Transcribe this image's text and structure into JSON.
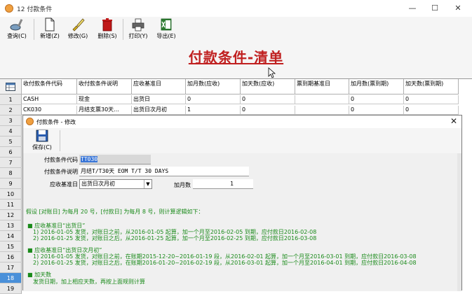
{
  "window": {
    "title": "12 付款条件",
    "min": "—",
    "max": "☐",
    "close": "✕"
  },
  "toolbar": [
    {
      "name": "query-button",
      "icon": "query-icon",
      "label": "查询(C)"
    },
    {
      "name": "add-button",
      "icon": "new-file-icon",
      "label": "新增(Z)"
    },
    {
      "name": "modify-button",
      "icon": "edit-brush-icon",
      "label": "修改(G)"
    },
    {
      "name": "delete-button",
      "icon": "trash-icon",
      "label": "删除(S)"
    },
    {
      "name": "print-button",
      "icon": "printer-icon",
      "label": "打印(Y)"
    },
    {
      "name": "export-button",
      "icon": "excel-icon",
      "label": "导出(E)"
    }
  ],
  "banner": {
    "title": "付款条件-清单"
  },
  "grid": {
    "columns": [
      "收付款条件代码",
      "收付款条件说明",
      "应收基准日",
      "加月数(应收)",
      "加天数(应收)",
      "票到期基准日",
      "加月数(票到期)",
      "加天数(票到期)"
    ],
    "rows": [
      {
        "num": "1",
        "cells": [
          "CASH",
          "现金",
          "出货日",
          "0",
          "0",
          "",
          "0",
          "0"
        ]
      },
      {
        "num": "2",
        "cells": [
          "CK030",
          "月结支票30天...",
          "出货日次月初",
          "1",
          "0",
          "",
          "0",
          "0"
        ]
      },
      {
        "num": "3"
      },
      {
        "num": "4"
      },
      {
        "num": "5"
      },
      {
        "num": "6"
      },
      {
        "num": "7"
      },
      {
        "num": "8"
      },
      {
        "num": "9"
      },
      {
        "num": "10"
      },
      {
        "num": "11"
      },
      {
        "num": "12"
      },
      {
        "num": "13"
      },
      {
        "num": "14"
      },
      {
        "num": "15"
      },
      {
        "num": "16"
      },
      {
        "num": "17"
      },
      {
        "num": "18"
      },
      {
        "num": "19"
      }
    ],
    "selected_row": "18"
  },
  "dialog": {
    "title": "付款条件 - 修改",
    "close": "✕",
    "save_label": "保存(C)",
    "fields": {
      "code_label": "付款条件代码",
      "code_value": "TT030",
      "desc_label": "付款条件说明",
      "desc_value": "月结T/T30天 EOM T/T 30 DAYS",
      "base_label": "应收基准日",
      "base_value": "出货日次月初",
      "months_label": "加月数",
      "months_value": "1"
    },
    "notes": {
      "intro": "假设 [对账日] 为每月 20 号，[付款日] 为每月 8 号，则计算逻辑如下：",
      "s1_head": "应收基准日“出货日”",
      "s1_l1": "1) 2016-01-05 发货，对账日之前，从2016-01-05 起算，加一个月至2016-02-05 到期，应付款日2016-02-08",
      "s1_l2": "2) 2016-01-25 发货，对账日之后，从2016-01-25 起算，加一个月至2016-02-25 到期，应付款日2016-03-08",
      "s2_head": "应收基准日“出货日次月初”",
      "s2_l1": "1) 2016-01-05 发货，对账日之前，在账期2015-12-20~2016-01-19 段，从2016-02-01 起算，加一个月至2016-03-01 到期，应付款日2016-03-08",
      "s2_l2": "2) 2016-01-25 发货，对账日之后，在账期2016-01-20~2016-02-19 段，从2016-03-01 起算，加一个月至2016-04-01 到期，应付款日2016-04-08",
      "s3_head": "加天数",
      "s3_l1": "发货日期，加上相应天数，再按上面规则计算"
    }
  }
}
